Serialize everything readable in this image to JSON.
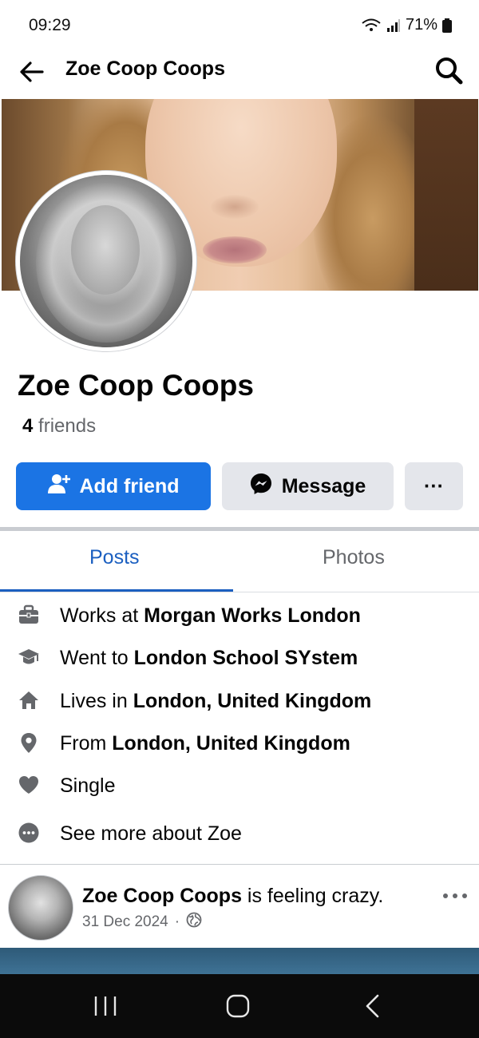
{
  "status_bar": {
    "time": "09:29",
    "network": "6E",
    "battery": "71%"
  },
  "header": {
    "title": "Zoe Coop Coops"
  },
  "profile": {
    "name": "Zoe Coop Coops",
    "friends_count": "4",
    "friends_label": "friends"
  },
  "actions": {
    "add_friend": "Add friend",
    "message": "Message",
    "more": "···"
  },
  "tabs": [
    {
      "label": "Posts",
      "active": true
    },
    {
      "label": "Photos",
      "active": false
    }
  ],
  "intro": [
    {
      "icon": "briefcase-icon",
      "prefix": "Works at ",
      "value": "Morgan Works London"
    },
    {
      "icon": "graduation-cap-icon",
      "prefix": "Went to ",
      "value": "London School SYstem"
    },
    {
      "icon": "home-icon",
      "prefix": "Lives in ",
      "value": "London, United Kingdom"
    },
    {
      "icon": "location-pin-icon",
      "prefix": "From ",
      "value": "London, United Kingdom"
    },
    {
      "icon": "heart-icon",
      "prefix": "",
      "value": "Single"
    },
    {
      "icon": "more-circle-icon",
      "prefix": "",
      "value": "See more about Zoe"
    }
  ],
  "post": {
    "author": "Zoe Coop Coops",
    "action": " is feeling crazy.",
    "date": "31 Dec 2024",
    "separator": "·",
    "privacy_icon": "globe-icon"
  },
  "colors": {
    "accent": "#1b74e4",
    "tab_active": "#1b5fc0",
    "secondary_text": "#65676b",
    "button_grey": "#e4e6eb"
  }
}
